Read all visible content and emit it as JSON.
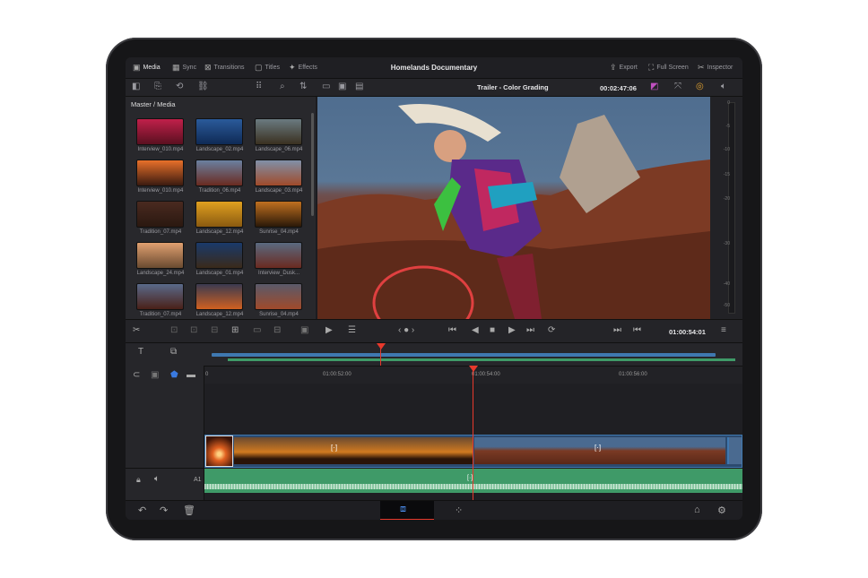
{
  "topbar": {
    "tabs": [
      {
        "label": "Media",
        "icon": "media-icon",
        "active": true
      },
      {
        "label": "Sync",
        "icon": "sync-icon"
      },
      {
        "label": "Transitions",
        "icon": "transitions-icon"
      },
      {
        "label": "Titles",
        "icon": "titles-icon"
      },
      {
        "label": "Effects",
        "icon": "effects-icon"
      }
    ],
    "project_title": "Homelands Documentary",
    "right": [
      {
        "label": "Export",
        "icon": "export-icon"
      },
      {
        "label": "Full Screen",
        "icon": "fullscreen-icon"
      },
      {
        "label": "Inspector",
        "icon": "inspector-icon"
      }
    ]
  },
  "toolbar": {
    "timeline_name": "Trailer - Color Grading",
    "source_timecode": "00:02:47:06"
  },
  "media_pool": {
    "breadcrumb": "Master / Media",
    "clips": [
      {
        "name": "Interview_010.mp4",
        "c1": "#c0204a",
        "c2": "#5a1020"
      },
      {
        "name": "Landscape_02.mp4",
        "c1": "#2a5a9a",
        "c2": "#0f2a55"
      },
      {
        "name": "Landscape_06.mp4",
        "c1": "#6a7a80",
        "c2": "#3a3020"
      },
      {
        "name": "Interview_010.mp4",
        "c1": "#e8702a",
        "c2": "#3a1a10"
      },
      {
        "name": "Tradition_06.mp4",
        "c1": "#6a80a0",
        "c2": "#6a2a20"
      },
      {
        "name": "Landscape_03.mp4",
        "c1": "#8090a8",
        "c2": "#a04a2a"
      },
      {
        "name": "Tradition_07.mp4",
        "c1": "#4a2a20",
        "c2": "#2a1810"
      },
      {
        "name": "Landscape_12.mp4",
        "c1": "#e0a020",
        "c2": "#8a5a10"
      },
      {
        "name": "Sunrise_04.mp4",
        "c1": "#c07020",
        "c2": "#2a1808"
      },
      {
        "name": "Landscape_24.mp4",
        "c1": "#e0a070",
        "c2": "#6a4a30"
      },
      {
        "name": "Landscape_01.mp4",
        "c1": "#1a3a6a",
        "c2": "#3a2a1a"
      },
      {
        "name": "Interview_Dusk...",
        "c1": "#5a6a80",
        "c2": "#6a2a20"
      },
      {
        "name": "Tradition_07.mp4",
        "c1": "#5a6a8a",
        "c2": "#4a2018"
      },
      {
        "name": "Landscape_12.mp4",
        "c1": "#3a3a50",
        "c2": "#d06020"
      },
      {
        "name": "Sunrise_04.mp4",
        "c1": "#5a5a6a",
        "c2": "#a04a2a"
      }
    ]
  },
  "meter": {
    "labels": [
      "0",
      "-5",
      "-10",
      "-15",
      "-20",
      "-30",
      "-40",
      "-50"
    ]
  },
  "transport": {
    "timecode": "01:00:54:01"
  },
  "ruler": {
    "labels": [
      "01:00:52:00",
      "01:00:54:00",
      "01:00:56:00"
    ],
    "start": "0"
  },
  "tracks": {
    "video": {
      "label": "1"
    },
    "audio": {
      "label": "A1"
    }
  },
  "colors": {
    "playhead": "#e8392c",
    "clip_blue": "#3f78b0",
    "audio_green": "#3f9a68"
  }
}
